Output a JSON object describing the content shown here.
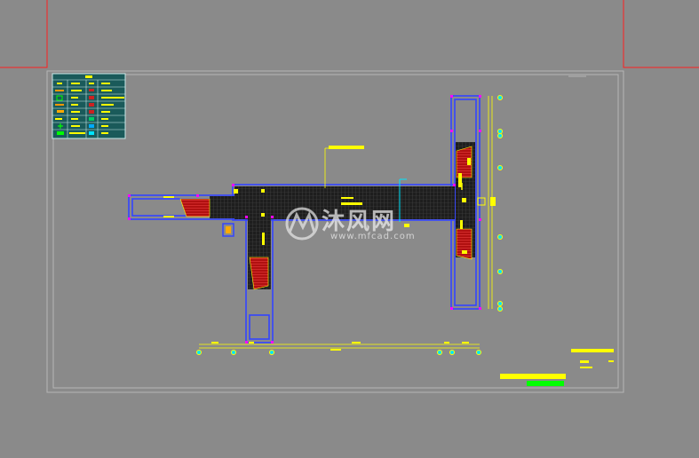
{
  "watermark": {
    "brand_text": "沐风网",
    "url_text": "www.mfcad.com",
    "logo_icon": "mf-logo-icon"
  },
  "colors": {
    "background": "#8a8a8a",
    "frame": "#b5b5b5",
    "red_border": "#ff2020",
    "wall_blue": "#3344ff",
    "magenta": "#ff00ff",
    "yellow": "#ffff00",
    "hatch": "#222222",
    "stair_red": "#c01010",
    "cyan": "#00e5ff",
    "green": "#00ff00",
    "legend_bg": "#1a6060"
  }
}
